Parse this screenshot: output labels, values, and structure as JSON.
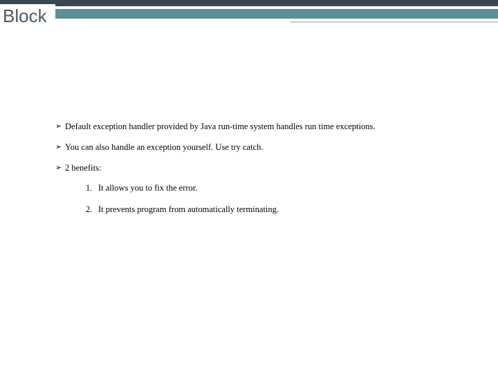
{
  "header": {
    "title": "Block"
  },
  "bullets": [
    "Default exception handler provided by Java run-time system handles run time exceptions.",
    "You can also handle an exception yourself. Use try catch.",
    "2 benefits:"
  ],
  "numbered": [
    {
      "n": "1.",
      "text": "It allows you to fix the error."
    },
    {
      "n": "2.",
      "text": "It prevents program from automatically terminating."
    }
  ]
}
